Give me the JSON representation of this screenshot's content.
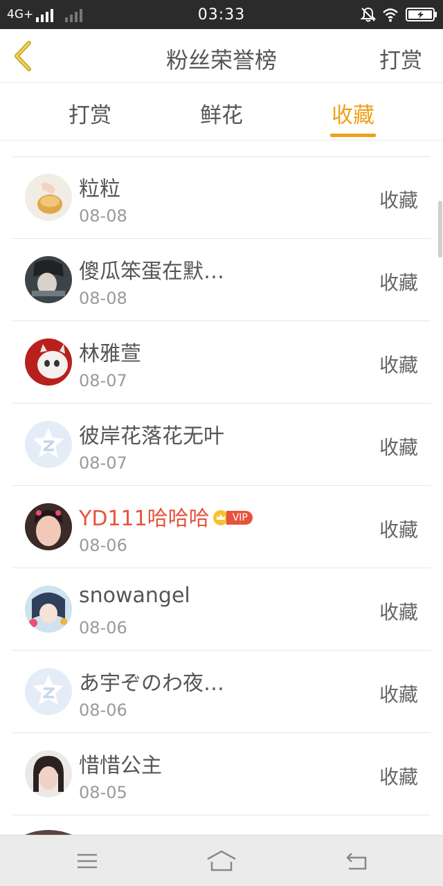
{
  "status_bar": {
    "network": "4G+",
    "time": "03:33",
    "icons": [
      "signal-icon",
      "signal-weak-icon",
      "mute-icon",
      "wifi-icon",
      "battery-charging-icon"
    ]
  },
  "header": {
    "back_icon": "chevron-left-icon",
    "title": "粉丝荣誉榜",
    "action_label": "打赏",
    "accent_color": "#f0a01a"
  },
  "tabs": [
    {
      "label": "打赏",
      "active": false
    },
    {
      "label": "鲜花",
      "active": false
    },
    {
      "label": "收藏",
      "active": true
    }
  ],
  "fans": [
    {
      "name": "粒粒",
      "date": "08-08",
      "action": "收藏",
      "avatar": "photo-avatar"
    },
    {
      "name": "傻瓜笨蛋在默…",
      "date": "08-08",
      "action": "收藏",
      "avatar": "photo-avatar"
    },
    {
      "name": "林雅萱",
      "date": "08-07",
      "action": "收藏",
      "avatar": "photo-avatar"
    },
    {
      "name": "彼岸花落花无叶",
      "date": "08-07",
      "action": "收藏",
      "avatar": "default-avatar"
    },
    {
      "name": "YD111哈哈哈",
      "date": "08-06",
      "action": "收藏",
      "avatar": "photo-avatar",
      "vip": true,
      "vip_label": "VIP"
    },
    {
      "name": "snowangel",
      "date": "08-06",
      "action": "收藏",
      "avatar": "photo-avatar"
    },
    {
      "name": "あ宇ぞのわ夜…",
      "date": "08-06",
      "action": "收藏",
      "avatar": "default-avatar"
    },
    {
      "name": "惜惜公主",
      "date": "08-05",
      "action": "收藏",
      "avatar": "photo-avatar"
    }
  ],
  "nav_bar": {
    "icons": [
      "menu-icon",
      "home-icon",
      "back-icon"
    ]
  }
}
